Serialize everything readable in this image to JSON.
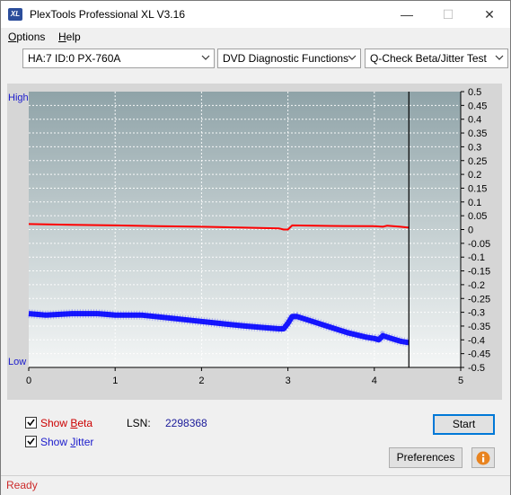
{
  "window": {
    "title": "PlexTools Professional XL V3.16",
    "icon_text": "XL"
  },
  "menu": [
    {
      "label_u": "O",
      "label_rest": "ptions"
    },
    {
      "label_u": "H",
      "label_rest": "elp"
    }
  ],
  "toolbar": {
    "drive": "HA:7 ID:0  PX-760A",
    "function": "DVD Diagnostic Functions",
    "test": "Q-Check Beta/Jitter Test"
  },
  "chart_data": {
    "type": "line",
    "y_top_label": "High",
    "y_bottom_label": "Low",
    "xlim": [
      0,
      5
    ],
    "x_ticks": [
      "0",
      "1",
      "2",
      "3",
      "4",
      "5"
    ],
    "ylim": [
      -0.5,
      0.5
    ],
    "y_ticks": [
      "0.5",
      "0.45",
      "0.4",
      "0.35",
      "0.3",
      "0.25",
      "0.2",
      "0.15",
      "0.1",
      "0.05",
      "0",
      "-0.05",
      "-0.1",
      "-0.15",
      "-0.2",
      "-0.25",
      "-0.3",
      "-0.35",
      "-0.4",
      "-0.45",
      "-0.5"
    ],
    "end_marker_x": 4.4,
    "series": [
      {
        "color": "#ff0000",
        "x": [
          0,
          0.5,
          1.0,
          1.5,
          2.0,
          2.5,
          2.9,
          2.95,
          3.0,
          3.05,
          3.5,
          4.0,
          4.1,
          4.15,
          4.3,
          4.4
        ],
        "y": [
          0.02,
          0.017,
          0.015,
          0.012,
          0.01,
          0.007,
          0.004,
          0.0,
          0.0,
          0.015,
          0.013,
          0.012,
          0.01,
          0.014,
          0.01,
          0.007
        ]
      },
      {
        "color": "#0000ff",
        "x": [
          0,
          0.2,
          0.5,
          0.8,
          1.0,
          1.3,
          1.6,
          1.9,
          2.2,
          2.5,
          2.7,
          2.9,
          2.95,
          3.0,
          3.05,
          3.1,
          3.3,
          3.5,
          3.7,
          3.9,
          4.0,
          4.05,
          4.1,
          4.2,
          4.3,
          4.4
        ],
        "y": [
          -0.305,
          -0.31,
          -0.305,
          -0.305,
          -0.31,
          -0.31,
          -0.32,
          -0.33,
          -0.34,
          -0.35,
          -0.355,
          -0.36,
          -0.36,
          -0.34,
          -0.315,
          -0.315,
          -0.335,
          -0.355,
          -0.375,
          -0.39,
          -0.395,
          -0.4,
          -0.385,
          -0.395,
          -0.405,
          -0.41
        ]
      }
    ]
  },
  "options": {
    "show_beta_u": "B",
    "show_beta_pre": "Show ",
    "show_beta_rest": "eta",
    "show_beta_checked": true,
    "show_jitter_u": "J",
    "show_jitter_pre": "Show ",
    "show_jitter_rest": "itter",
    "show_jitter_checked": true,
    "lsn_label": "LSN:",
    "lsn_value": "2298368"
  },
  "buttons": {
    "start": "Start",
    "preferences": "Preferences",
    "info_icon": "info-icon"
  },
  "status": "Ready",
  "colors": {
    "beta": "#cc0000",
    "jitter": "#1a1acc",
    "status": "#cc2b2b"
  }
}
